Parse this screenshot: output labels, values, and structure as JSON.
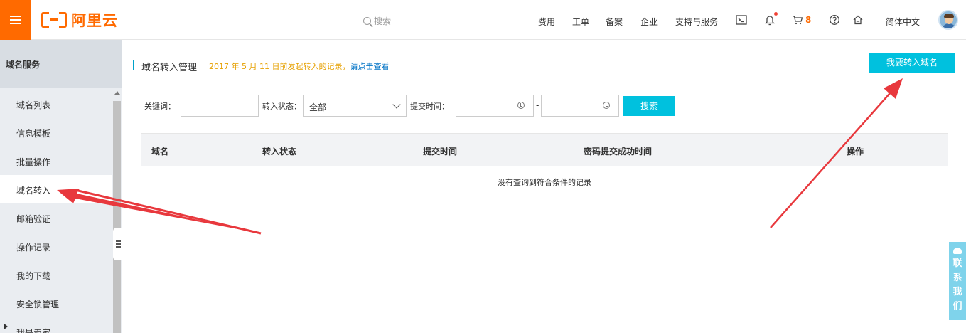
{
  "header": {
    "logo_text": "阿里云",
    "search_placeholder": "搜索",
    "nav": [
      "费用",
      "工单",
      "备案",
      "企业",
      "支持与服务"
    ],
    "cart_count": "8",
    "language": "简体中文",
    "icons": [
      "terminal-icon",
      "bell-icon",
      "cart-icon",
      "help-icon",
      "home-icon"
    ]
  },
  "sidebar": {
    "title": "域名服务",
    "items": [
      {
        "label": "域名列表"
      },
      {
        "label": "信息模板"
      },
      {
        "label": "批量操作"
      },
      {
        "label": "域名转入",
        "active": true
      },
      {
        "label": "邮箱验证"
      },
      {
        "label": "操作记录"
      },
      {
        "label": "我的下载"
      },
      {
        "label": "安全锁管理"
      },
      {
        "label": "我是卖家"
      }
    ]
  },
  "main": {
    "title": "域名转入管理",
    "notice_text": "2017 年 5 月 11 日前发起转入的记录，",
    "notice_link": "请点击查看",
    "transfer_button": "我要转入域名",
    "filters": {
      "keyword_label": "关键词：",
      "keyword_value": "",
      "status_label": "转入状态：",
      "status_value": "全部",
      "time_label": "提交时间：",
      "date_sep": "-",
      "search_button": "搜索"
    },
    "table": {
      "columns": [
        "域名",
        "转入状态",
        "提交时间",
        "密码提交成功时间",
        "操作"
      ],
      "empty_text": "没有查询到符合条件的记录"
    }
  },
  "contact": {
    "label": [
      "联",
      "系",
      "我",
      "们"
    ]
  },
  "colors": {
    "brand": "#ff6a00",
    "primary": "#00c1de",
    "annotation_arrow": "#e8383d"
  }
}
